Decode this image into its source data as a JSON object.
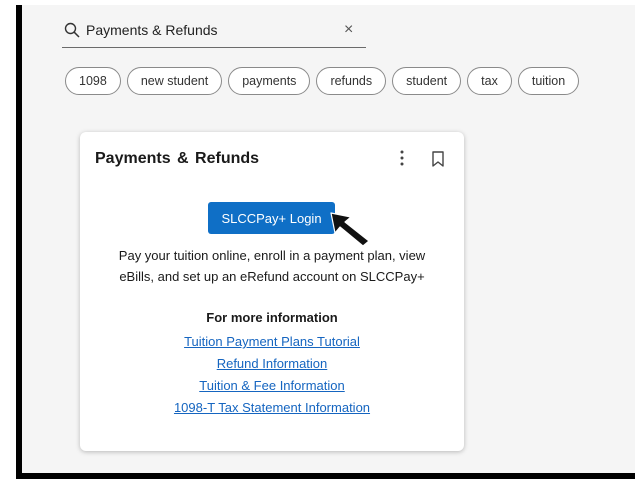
{
  "search": {
    "value": "Payments & Refunds",
    "clear_symbol": "×",
    "icon": "search-icon"
  },
  "chips": [
    "1098",
    "new student",
    "payments",
    "refunds",
    "student",
    "tax",
    "tuition"
  ],
  "card": {
    "title": "Payments & Refunds",
    "login_button": "SLCCPay+ Login",
    "description_line1": "Pay your tuition online, enroll in a payment plan, view",
    "description_line2": "eBills, and set up an eRefund account on SLCCPay+",
    "more_info_heading": "For more information",
    "links": [
      "Tuition Payment Plans Tutorial",
      "Refund Information",
      "Tuition & Fee Information",
      "1098-T Tax Statement Information"
    ]
  },
  "colors": {
    "button": "#0f6fc6",
    "link": "#1565c0"
  }
}
